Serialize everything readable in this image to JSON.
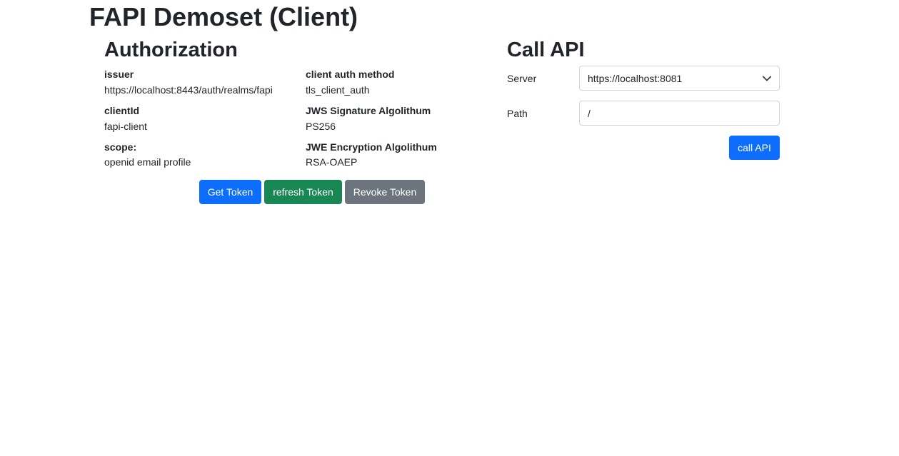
{
  "page": {
    "title": "FAPI Demoset (Client)"
  },
  "authorization": {
    "title": "Authorization",
    "fields": {
      "issuer": {
        "label": "issuer",
        "value": "https://localhost:8443/auth/realms/fapi"
      },
      "client_auth_method": {
        "label": "client auth method",
        "value": "tls_client_auth"
      },
      "client_id": {
        "label": "clientId",
        "value": "fapi-client"
      },
      "jws_signature": {
        "label": "JWS Signature Algolithum",
        "value": "PS256"
      },
      "scope": {
        "label": "scope:",
        "value": "openid email profile"
      },
      "jwe_encryption": {
        "label": "JWE Encryption Algolithum",
        "value": "RSA-OAEP"
      }
    },
    "buttons": {
      "get_token": "Get Token",
      "refresh_token": "refresh Token",
      "revoke_token": "Revoke Token"
    }
  },
  "call_api": {
    "title": "Call API",
    "server": {
      "label": "Server",
      "selected": "https://localhost:8081"
    },
    "path": {
      "label": "Path",
      "value": "/"
    },
    "button": "call API"
  },
  "colors": {
    "primary": "#0d6efd",
    "success": "#198754",
    "secondary": "#6c757d",
    "text": "#212529",
    "border": "#ced4da"
  }
}
